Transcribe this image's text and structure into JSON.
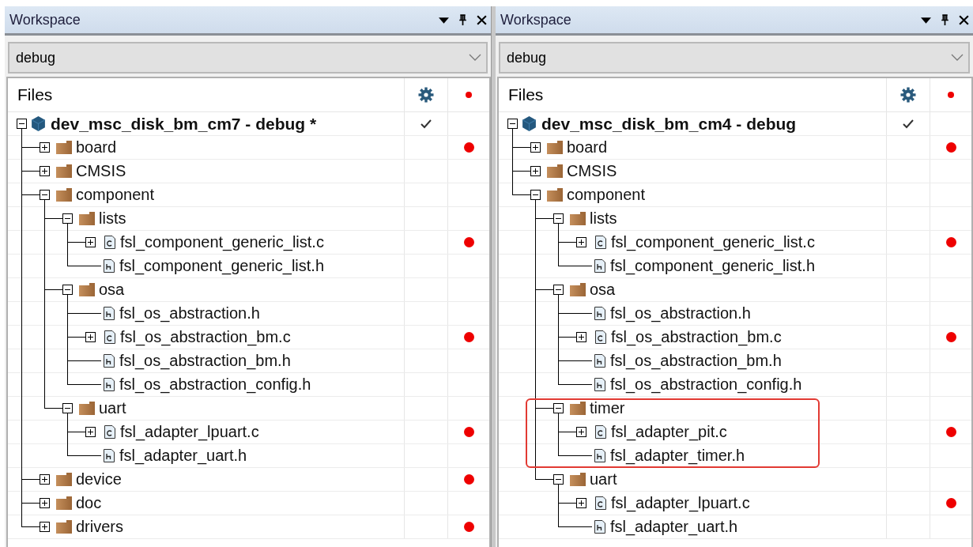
{
  "panels": [
    {
      "title": "Workspace",
      "configuration": "debug",
      "tree_header": "Files",
      "tree": [
        {
          "name": "dev_msc_disk_bm_cm7 - debug *",
          "kind": "project",
          "expanded": true,
          "check": true,
          "dot": false,
          "highlighted": false,
          "children": [
            {
              "name": "board",
              "kind": "folder",
              "expanded": false,
              "check": false,
              "dot": true,
              "highlighted": false
            },
            {
              "name": "CMSIS",
              "kind": "folder",
              "expanded": false,
              "check": false,
              "dot": false,
              "highlighted": false
            },
            {
              "name": "component",
              "kind": "folder",
              "expanded": true,
              "check": false,
              "dot": false,
              "highlighted": false,
              "children": [
                {
                  "name": "lists",
                  "kind": "folder",
                  "expanded": true,
                  "check": false,
                  "dot": false,
                  "highlighted": false,
                  "children": [
                    {
                      "name": "fsl_component_generic_list.c",
                      "kind": "source",
                      "expanded": false,
                      "check": false,
                      "dot": true,
                      "highlighted": false
                    },
                    {
                      "name": "fsl_component_generic_list.h",
                      "kind": "header",
                      "expanded": false,
                      "check": false,
                      "dot": false,
                      "highlighted": false
                    }
                  ]
                },
                {
                  "name": "osa",
                  "kind": "folder",
                  "expanded": true,
                  "check": false,
                  "dot": false,
                  "highlighted": false,
                  "children": [
                    {
                      "name": "fsl_os_abstraction.h",
                      "kind": "header",
                      "expanded": false,
                      "check": false,
                      "dot": false,
                      "highlighted": false
                    },
                    {
                      "name": "fsl_os_abstraction_bm.c",
                      "kind": "source",
                      "expanded": false,
                      "check": false,
                      "dot": true,
                      "highlighted": false
                    },
                    {
                      "name": "fsl_os_abstraction_bm.h",
                      "kind": "header",
                      "expanded": false,
                      "check": false,
                      "dot": false,
                      "highlighted": false
                    },
                    {
                      "name": "fsl_os_abstraction_config.h",
                      "kind": "header",
                      "expanded": false,
                      "check": false,
                      "dot": false,
                      "highlighted": false
                    }
                  ]
                },
                {
                  "name": "uart",
                  "kind": "folder",
                  "expanded": true,
                  "check": false,
                  "dot": false,
                  "highlighted": false,
                  "children": [
                    {
                      "name": "fsl_adapter_lpuart.c",
                      "kind": "source",
                      "expanded": false,
                      "check": false,
                      "dot": true,
                      "highlighted": false
                    },
                    {
                      "name": "fsl_adapter_uart.h",
                      "kind": "header",
                      "expanded": false,
                      "check": false,
                      "dot": false,
                      "highlighted": false
                    }
                  ]
                }
              ]
            },
            {
              "name": "device",
              "kind": "folder",
              "expanded": false,
              "check": false,
              "dot": true,
              "highlighted": false
            },
            {
              "name": "doc",
              "kind": "folder",
              "expanded": false,
              "check": false,
              "dot": false,
              "highlighted": false
            },
            {
              "name": "drivers",
              "kind": "folder",
              "expanded": false,
              "check": false,
              "dot": true,
              "highlighted": false
            }
          ]
        }
      ]
    },
    {
      "title": "Workspace",
      "configuration": "debug",
      "tree_header": "Files",
      "tree": [
        {
          "name": "dev_msc_disk_bm_cm4 - debug",
          "kind": "project",
          "expanded": true,
          "check": true,
          "dot": false,
          "highlighted": false,
          "children": [
            {
              "name": "board",
              "kind": "folder",
              "expanded": false,
              "check": false,
              "dot": true,
              "highlighted": false
            },
            {
              "name": "CMSIS",
              "kind": "folder",
              "expanded": false,
              "check": false,
              "dot": false,
              "highlighted": false
            },
            {
              "name": "component",
              "kind": "folder",
              "expanded": true,
              "check": false,
              "dot": false,
              "highlighted": false,
              "children": [
                {
                  "name": "lists",
                  "kind": "folder",
                  "expanded": true,
                  "check": false,
                  "dot": false,
                  "highlighted": false,
                  "children": [
                    {
                      "name": "fsl_component_generic_list.c",
                      "kind": "source",
                      "expanded": false,
                      "check": false,
                      "dot": true,
                      "highlighted": false
                    },
                    {
                      "name": "fsl_component_generic_list.h",
                      "kind": "header",
                      "expanded": false,
                      "check": false,
                      "dot": false,
                      "highlighted": false
                    }
                  ]
                },
                {
                  "name": "osa",
                  "kind": "folder",
                  "expanded": true,
                  "check": false,
                  "dot": false,
                  "highlighted": false,
                  "children": [
                    {
                      "name": "fsl_os_abstraction.h",
                      "kind": "header",
                      "expanded": false,
                      "check": false,
                      "dot": false,
                      "highlighted": false
                    },
                    {
                      "name": "fsl_os_abstraction_bm.c",
                      "kind": "source",
                      "expanded": false,
                      "check": false,
                      "dot": true,
                      "highlighted": false
                    },
                    {
                      "name": "fsl_os_abstraction_bm.h",
                      "kind": "header",
                      "expanded": false,
                      "check": false,
                      "dot": false,
                      "highlighted": false
                    },
                    {
                      "name": "fsl_os_abstraction_config.h",
                      "kind": "header",
                      "expanded": false,
                      "check": false,
                      "dot": false,
                      "highlighted": false
                    }
                  ]
                },
                {
                  "name": "timer",
                  "kind": "folder",
                  "expanded": true,
                  "check": false,
                  "dot": false,
                  "highlighted": true,
                  "children": [
                    {
                      "name": "fsl_adapter_pit.c",
                      "kind": "source",
                      "expanded": false,
                      "check": false,
                      "dot": true,
                      "highlighted": false
                    },
                    {
                      "name": "fsl_adapter_timer.h",
                      "kind": "header",
                      "expanded": false,
                      "check": false,
                      "dot": false,
                      "highlighted": false
                    }
                  ]
                },
                {
                  "name": "uart",
                  "kind": "folder",
                  "expanded": true,
                  "check": false,
                  "dot": false,
                  "highlighted": false,
                  "children": [
                    {
                      "name": "fsl_adapter_lpuart.c",
                      "kind": "source",
                      "expanded": false,
                      "check": false,
                      "dot": true,
                      "highlighted": false
                    },
                    {
                      "name": "fsl_adapter_uart.h",
                      "kind": "header",
                      "expanded": false,
                      "check": false,
                      "dot": false,
                      "highlighted": false
                    }
                  ]
                }
              ]
            }
          ]
        }
      ]
    }
  ]
}
